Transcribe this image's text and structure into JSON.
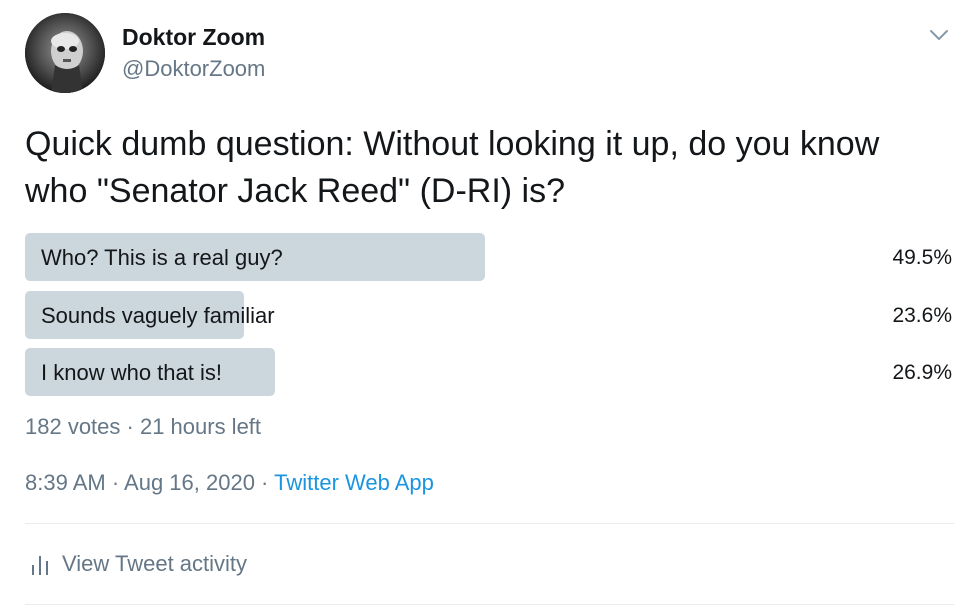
{
  "user": {
    "display_name": "Doktor Zoom",
    "handle": "@DoktorZoom",
    "avatar_icon": "user-avatar"
  },
  "tweet": {
    "text": "Quick dumb question: Without looking it up, do you know who \"Senator Jack Reed\" (D-RI) is?"
  },
  "poll": {
    "options": [
      {
        "label": "Who? This is a real guy?",
        "percent_text": "49.5%",
        "percent": 49.5
      },
      {
        "label": "Sounds vaguely familiar",
        "percent_text": "23.6%",
        "percent": 23.6
      },
      {
        "label": "I know who that is!",
        "percent_text": "26.9%",
        "percent": 26.9
      }
    ],
    "meta": "182 votes · 21 hours left"
  },
  "timestamp": {
    "time_date": "8:39 AM · Aug 16, 2020 · ",
    "source": "Twitter Web App"
  },
  "activity": {
    "label": "View Tweet activity",
    "icon": "bar-chart-icon"
  },
  "colors": {
    "bar": "#ccd6dd",
    "link": "#1b95e0",
    "secondary_text": "#657786"
  }
}
